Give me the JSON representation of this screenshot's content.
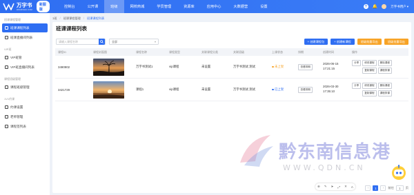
{
  "brand": {
    "name": "万字书",
    "sub": "WANZISHU.COM",
    "badge": "新服版"
  },
  "nav": [
    {
      "label": "控制台"
    },
    {
      "label": "公开课"
    },
    {
      "label": "班级",
      "active": true
    },
    {
      "label": "网校商城"
    },
    {
      "label": "学员管理"
    },
    {
      "label": "资源库"
    },
    {
      "label": "应用中心"
    },
    {
      "label": "大数据营"
    },
    {
      "label": "设置"
    }
  ],
  "user": {
    "name": "万字书用户"
  },
  "sidebar": {
    "groups": [
      {
        "title": "班课课程管理",
        "items": [
          {
            "label": "班课课程列表",
            "active": true
          },
          {
            "label": "班课直播间列表"
          }
        ]
      },
      {
        "title": "VIP班",
        "items": [
          {
            "label": "VIP班管"
          },
          {
            "label": "VIP班直播间列表"
          }
        ]
      },
      {
        "title": "课程班级管理",
        "items": [
          {
            "label": "课程班级管理"
          }
        ]
      },
      {
        "title": "1V1约课",
        "items": [
          {
            "label": "约课设置"
          },
          {
            "label": "老师管理"
          },
          {
            "label": "课程签列表"
          }
        ]
      }
    ]
  },
  "breadcrumb": {
    "root": "1班",
    "parent": "班课课程管理",
    "current": "班课课程列表"
  },
  "page": {
    "title": "班课课程列表"
  },
  "filters": {
    "search_placeholder": "请输入课程名称",
    "select_value": "全部"
  },
  "actions": {
    "create_lesson": "+ 创建课程包",
    "create_course": "+ 创建新课程",
    "btn_c": "班级批量导出",
    "btn_d": "班级批量导出"
  },
  "table": {
    "headers": [
      "课程ID",
      "课程封面图",
      "课程名称",
      "课程类型",
      "关联课程分类",
      "关联班级",
      "上课状态",
      "排期",
      "创建时间",
      "操作"
    ],
    "rows": [
      {
        "id": "3490902",
        "name": "万字书测试1",
        "type": "vip课程",
        "category": "",
        "class": "未设置",
        "teacher": "万字书测试 测试",
        "status": "未上架",
        "status_color": "#f7a326",
        "schedule_btn": "查看排期",
        "created": "2026-06-15 17:21:15",
        "ops": [
          "分享",
          "修改课程",
          "删除课程",
          "复制课程",
          "课程排课"
        ]
      },
      {
        "id": "3421729",
        "name": "课程1",
        "type": "vip课程",
        "category": "",
        "class": "未设置",
        "teacher": "万字书测试 测试",
        "status": "已上架",
        "status_color": "#2f6ef2",
        "schedule_btn": "查看排期",
        "created": "2026-03-30 17:35:10",
        "ops": [
          "分享",
          "修改课程",
          "删除课程",
          "复制课程",
          "课程排课"
        ]
      }
    ]
  },
  "pager": {
    "current": "1",
    "goto_label": "前往",
    "goto_value": "1",
    "page_unit": "页"
  },
  "watermark": {
    "title": "黔东南信息港",
    "url": "WWW.QDN.CN"
  },
  "float_tools": [
    "⊕",
    "✎",
    "➤",
    "⤢",
    "✕",
    "A"
  ]
}
